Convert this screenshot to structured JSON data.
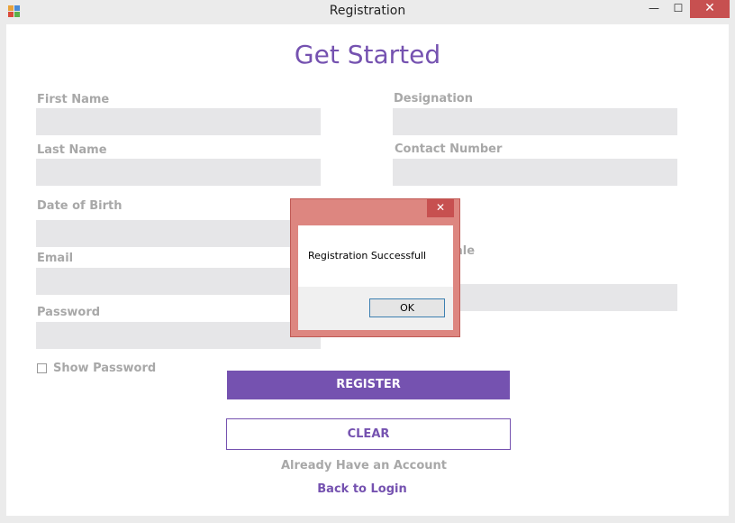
{
  "window": {
    "title": "Registration",
    "minimize_glyph": "—",
    "maximize_glyph": "☐",
    "close_glyph": "✕"
  },
  "form": {
    "heading": "Get Started",
    "first_name_label": "First Name",
    "last_name_label": "Last Name",
    "dob_label": "Date of Birth",
    "email_label": "Email",
    "password_label": "Password",
    "designation_label": "Designation",
    "contact_label": "Contact Number",
    "gender_label_partial": "ale",
    "show_password_label": "Show Password",
    "register_label": "REGISTER",
    "clear_label": "CLEAR",
    "account_text": "Already Have an Account",
    "back_link": "Back to Login"
  },
  "dialog": {
    "message": "Registration Successfull",
    "ok_label": "OK",
    "close_glyph": "✕"
  },
  "colors": {
    "accent": "#7552b0",
    "field_bg": "#e6e6e8",
    "label": "#a8a8a8",
    "dialog_frame": "#dd8680",
    "close_red": "#c75050"
  }
}
